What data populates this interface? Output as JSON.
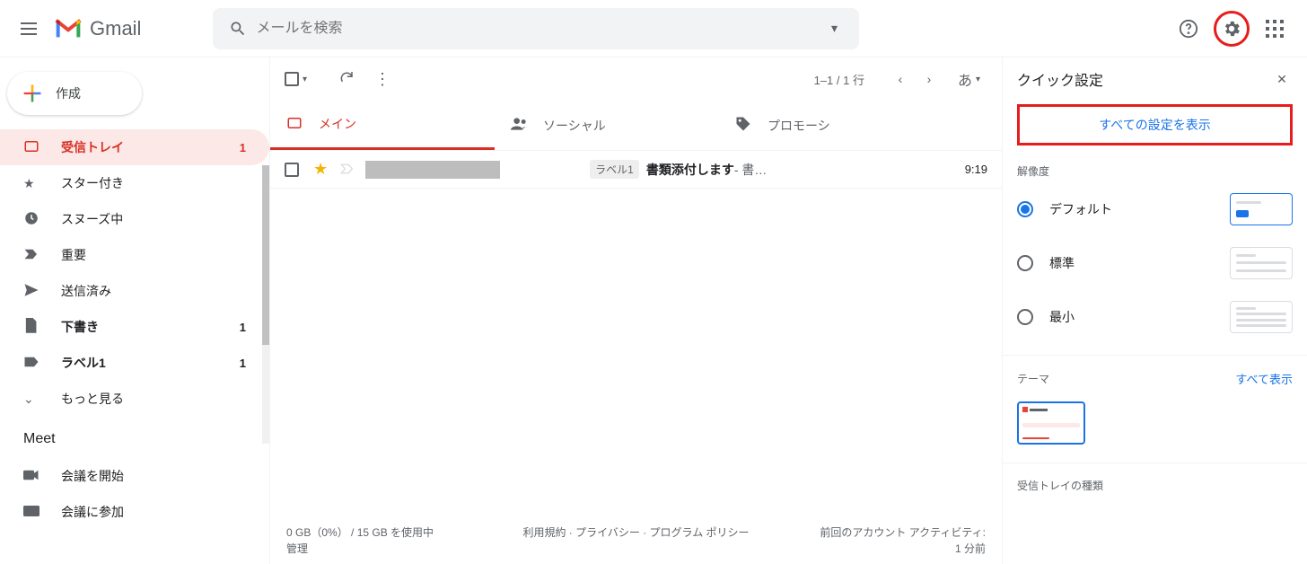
{
  "header": {
    "product_name": "Gmail",
    "search_placeholder": "メールを検索"
  },
  "compose_label": "作成",
  "nav": [
    {
      "icon": "inbox",
      "label": "受信トレイ",
      "count": "1",
      "active": true,
      "bold": true
    },
    {
      "icon": "star",
      "label": "スター付き"
    },
    {
      "icon": "clock",
      "label": "スヌーズ中"
    },
    {
      "icon": "important",
      "label": "重要"
    },
    {
      "icon": "send",
      "label": "送信済み"
    },
    {
      "icon": "draft",
      "label": "下書き",
      "count": "1",
      "bold": true
    },
    {
      "icon": "label",
      "label": "ラベル1",
      "count": "1",
      "bold": true
    },
    {
      "icon": "more",
      "label": "もっと見る"
    }
  ],
  "meet": {
    "title": "Meet",
    "start": "会議を開始",
    "join": "会議に参加"
  },
  "toolbar": {
    "paging": "1–1 / 1 行",
    "ime": "あ"
  },
  "tabs": {
    "main": "メイン",
    "social": "ソーシャル",
    "promo": "プロモーシ"
  },
  "mail": {
    "label": "ラベル1",
    "subject": "書類添付します",
    "snippet": " - 書…",
    "time": "9:19"
  },
  "footer": {
    "storage_line1": "0 GB（0%） / 15 GB を使用中",
    "storage_line2": "管理",
    "policy": "利用規約 · プライバシー · プログラム ポリシー",
    "activity_line1": "前回のアカウント アクティビティ:",
    "activity_line2": "1 分前"
  },
  "qsettings": {
    "title": "クイック設定",
    "all_settings": "すべての設定を表示",
    "density_label": "解像度",
    "density": {
      "default": "デフォルト",
      "standard": "標準",
      "compact": "最小"
    },
    "theme_label": "テーマ",
    "theme_link": "すべて表示",
    "inbox_type_label": "受信トレイの種類"
  }
}
